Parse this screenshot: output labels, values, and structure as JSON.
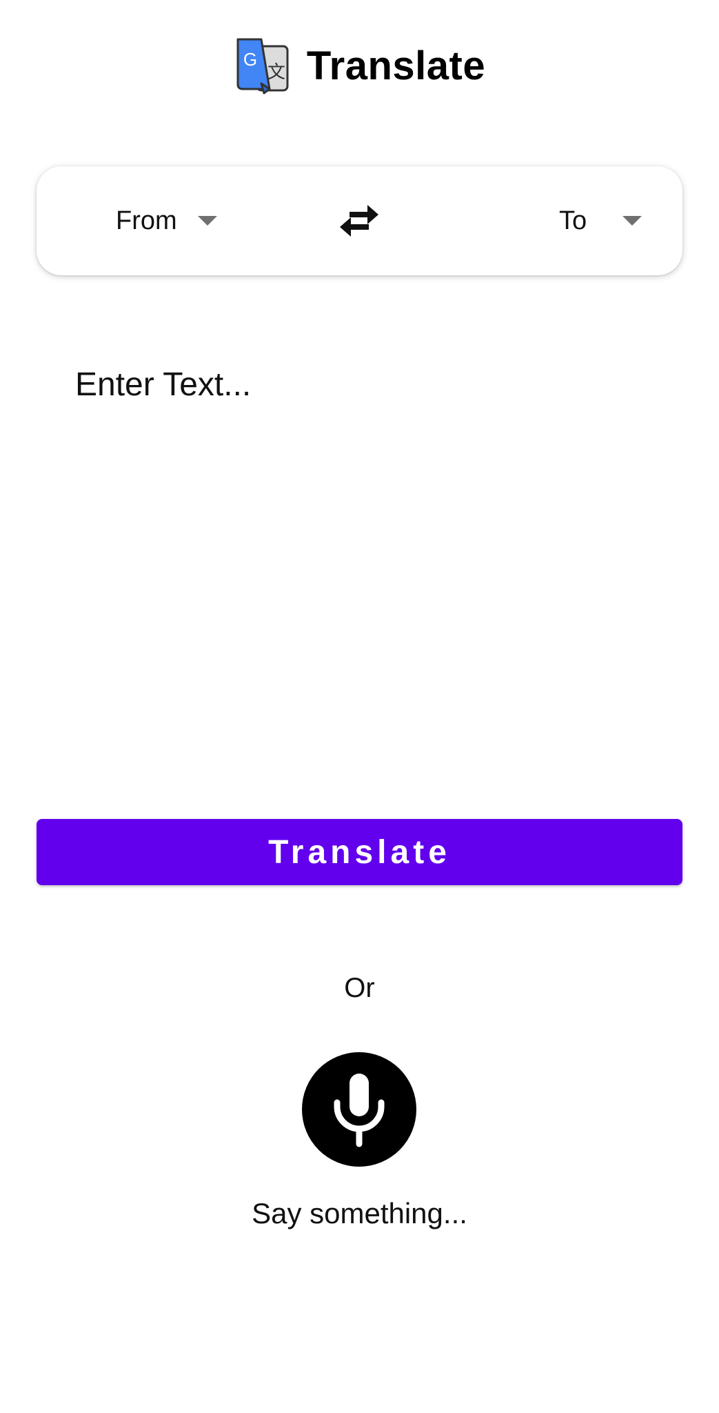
{
  "header": {
    "title": "Translate",
    "logo_icon": "google-translate-icon",
    "logo_letter": "G",
    "logo_glyph": "文"
  },
  "language_bar": {
    "from_label": "From",
    "to_label": "To",
    "swap_icon": "swap-arrows-icon",
    "dropdown_icon": "arrow-drop-down-icon"
  },
  "input": {
    "placeholder": "Enter Text...",
    "value": ""
  },
  "translate_button": {
    "label": "Translate"
  },
  "divider_text": "Or",
  "voice": {
    "mic_icon": "microphone-icon",
    "prompt": "Say something..."
  },
  "colors": {
    "primary": "#6200ee",
    "logo_blue": "#4285f4",
    "logo_gray": "#dcdcdc",
    "mic_background": "#000000",
    "caret": "#707070"
  }
}
